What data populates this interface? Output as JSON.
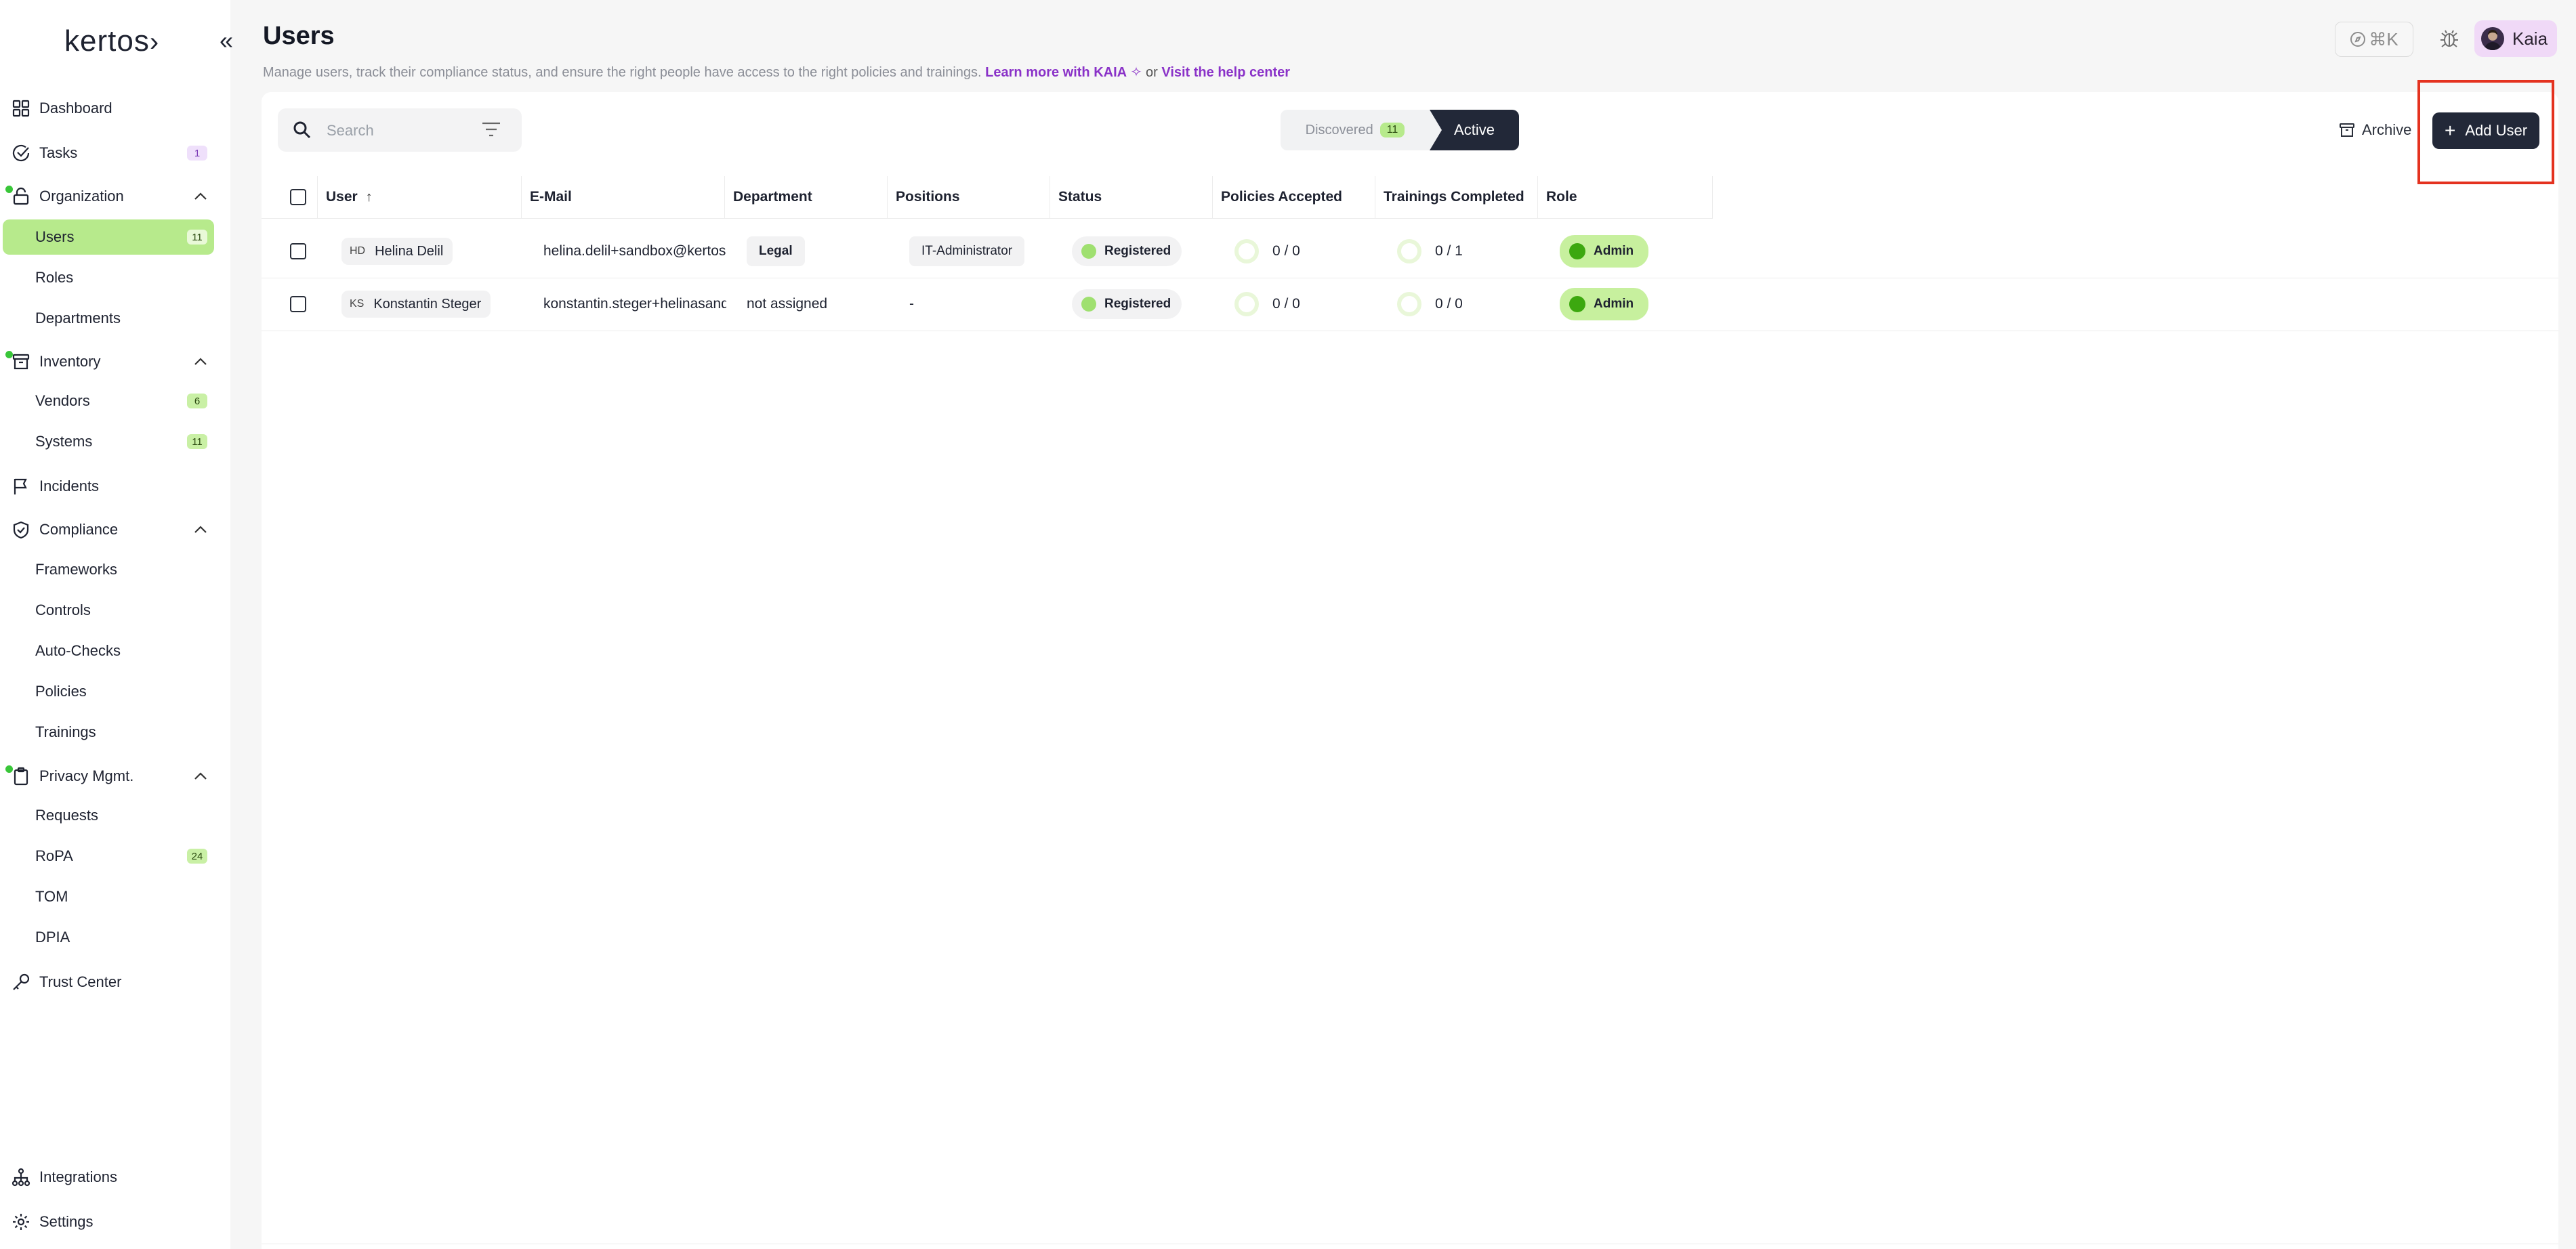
{
  "brand": {
    "name": "kertos",
    "logo_suffix": "›"
  },
  "sidebar": {
    "nav": {
      "dashboard": "Dashboard",
      "tasks": "Tasks",
      "tasks_count": "1",
      "organization": "Organization",
      "users": "Users",
      "users_count": "11",
      "roles": "Roles",
      "departments": "Departments",
      "inventory": "Inventory",
      "vendors": "Vendors",
      "vendors_count": "6",
      "systems": "Systems",
      "systems_count": "11",
      "incidents": "Incidents",
      "compliance": "Compliance",
      "frameworks": "Frameworks",
      "controls": "Controls",
      "autochecks": "Auto-Checks",
      "policies": "Policies",
      "trainings": "Trainings",
      "privacy": "Privacy Mgmt.",
      "requests": "Requests",
      "ropa": "RoPA",
      "ropa_count": "24",
      "tom": "TOM",
      "dpia": "DPIA",
      "trust_center": "Trust Center",
      "integrations": "Integrations",
      "settings": "Settings"
    }
  },
  "header": {
    "title": "Users",
    "subtitle_text": "Manage users, track their compliance status, and ensure the right people have access to the right policies and trainings.",
    "learn_more": "Learn more with KAIA",
    "or": "or",
    "help_center": "Visit the help center",
    "shortcut": "⌘K",
    "user_name": "Kaia"
  },
  "toolbar": {
    "search_placeholder": "Search",
    "discovered_label": "Discovered",
    "discovered_count": "11",
    "active_label": "Active",
    "archive_label": "Archive",
    "add_user_label": "Add User"
  },
  "table": {
    "columns": {
      "user": "User",
      "email": "E-Mail",
      "department": "Department",
      "positions": "Positions",
      "status": "Status",
      "policies": "Policies Accepted",
      "trainings": "Trainings Completed",
      "role": "Role"
    },
    "rows": [
      {
        "initials": "HD",
        "name": "Helina Delil",
        "email": "helina.delil+sandbox@kertos.io",
        "department": "Legal",
        "position": "IT-Administrator",
        "status": "Registered",
        "policies": "0 / 0",
        "trainings": "0 / 1",
        "role": "Admin"
      },
      {
        "initials": "KS",
        "name": "Konstantin Steger",
        "email": "konstantin.steger+helinasandb",
        "department": "not assigned",
        "position": "-",
        "status": "Registered",
        "policies": "0 / 0",
        "trainings": "0 / 0",
        "role": "Admin"
      }
    ]
  },
  "colors": {
    "accent_green": "#b7ea8c",
    "dark": "#222838",
    "link_purple": "#8a32c8",
    "highlight_red": "#e4321f"
  }
}
